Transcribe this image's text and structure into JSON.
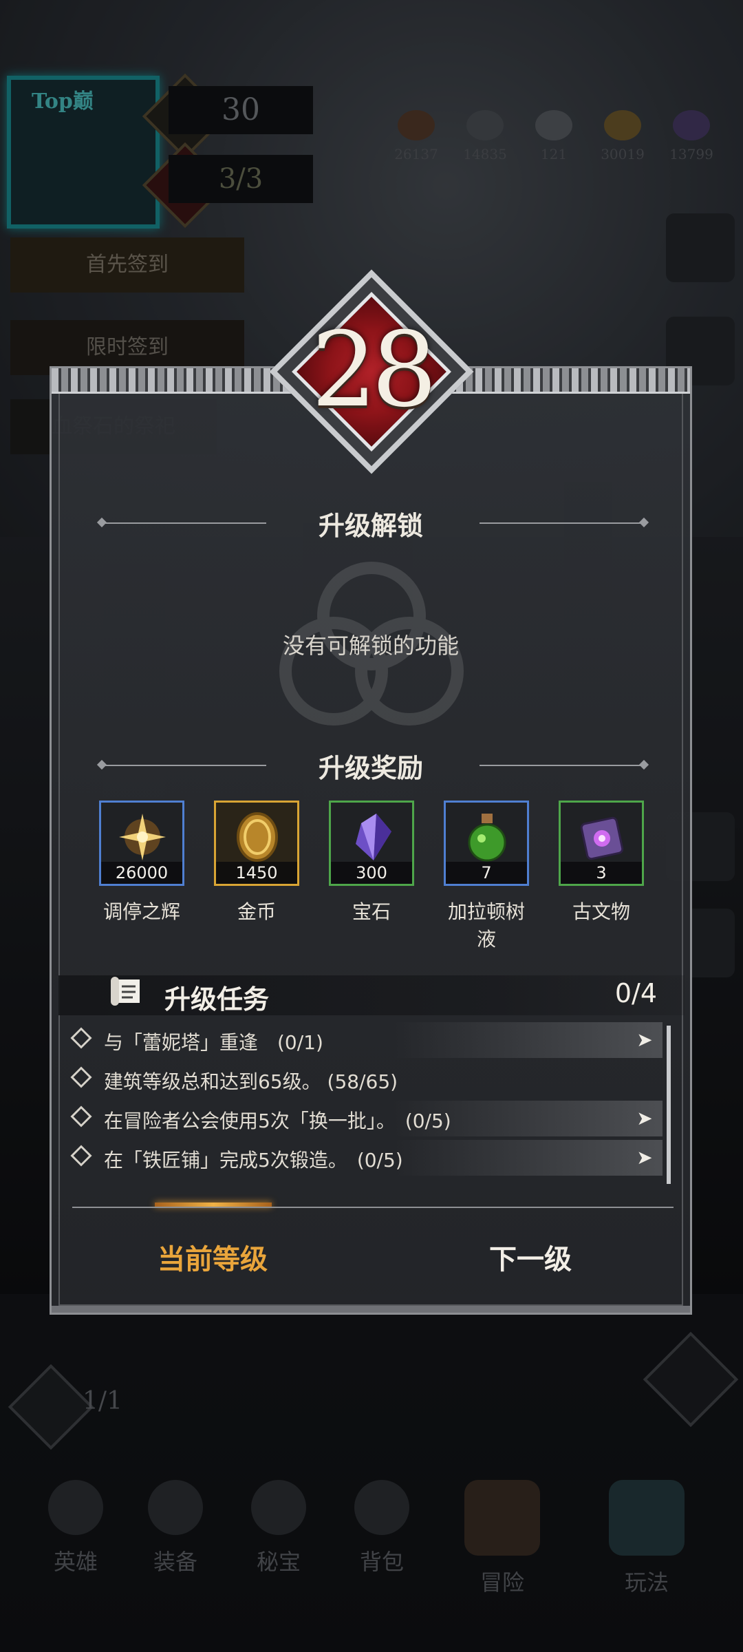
{
  "hud": {
    "vip_label": "Top巅",
    "player_level": "30",
    "energy": "3/3",
    "resources": [
      {
        "name": "crate-icon",
        "value": "26137",
        "color": "#6a4a35"
      },
      {
        "name": "ore-icon",
        "value": "14835",
        "color": "#60656c"
      },
      {
        "name": "iron-icon",
        "value": "121",
        "color": "#70757c"
      },
      {
        "name": "gold-icon",
        "value": "30019",
        "color": "#8a7038"
      },
      {
        "name": "crystal-icon",
        "value": "13799",
        "color": "#5a4a80"
      }
    ],
    "side_buttons": [
      "首先签到",
      "限时签到",
      "血祭石的祭祀"
    ],
    "hammer_count": "1/1"
  },
  "bottom_nav": [
    {
      "label": "英雄"
    },
    {
      "label": "装备"
    },
    {
      "label": "秘宝"
    },
    {
      "label": "背包"
    },
    {
      "label": "冒险"
    },
    {
      "label": "玩法"
    }
  ],
  "panel": {
    "level": "28",
    "unlock_title": "升级解锁",
    "unlock_empty": "没有可解锁的功能",
    "reward_title": "升级奖励",
    "rewards": [
      {
        "qty": "26000",
        "name": "调停之辉",
        "border": "#4f7fd1",
        "art": "star"
      },
      {
        "qty": "1450",
        "name": "金币",
        "border": "#d9a534",
        "art": "coin"
      },
      {
        "qty": "300",
        "name": "宝石",
        "border": "#4ea64a",
        "art": "crystal"
      },
      {
        "qty": "7",
        "name": "加拉顿树液",
        "border": "#4f7fd1",
        "art": "potion"
      },
      {
        "qty": "3",
        "name": "古文物",
        "border": "#4ea64a",
        "art": "relic"
      }
    ],
    "task_title": "升级任务",
    "task_count": "0/4",
    "tasks": [
      {
        "text": "与「蕾妮塔」重逢　(0/1)",
        "go": true
      },
      {
        "text": "建筑等级总和达到65级。 (58/65)",
        "go": false
      },
      {
        "text": "在冒险者公会使用5次「换一批」。　(0/5)",
        "go": true
      },
      {
        "text": "在「铁匠铺」完成5次锻造。　(0/5)",
        "go": true
      }
    ],
    "tabs": {
      "current": "当前等级",
      "next": "下一级",
      "active": "current"
    }
  }
}
